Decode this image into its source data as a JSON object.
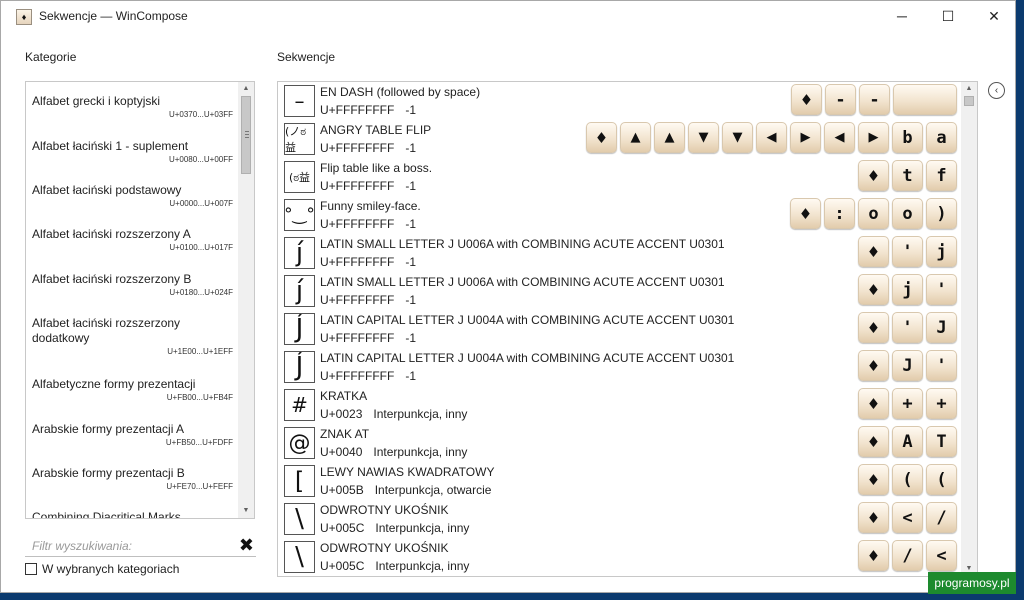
{
  "window": {
    "title": "Sekwencje — WinCompose",
    "icon": "compose-diamond-icon",
    "controls": {
      "minimize": "─",
      "maximize": "☐",
      "close": "✕"
    }
  },
  "categories": {
    "label": "Kategorie",
    "items": [
      {
        "name": "Alfabet grecki i koptyjski",
        "range": "U+0370...U+03FF"
      },
      {
        "name": "Alfabet łaciński 1 - suplement",
        "range": "U+0080...U+00FF"
      },
      {
        "name": "Alfabet łaciński podstawowy",
        "range": "U+0000...U+007F"
      },
      {
        "name": "Alfabet łaciński rozszerzony A",
        "range": "U+0100...U+017F"
      },
      {
        "name": "Alfabet łaciński rozszerzony B",
        "range": "U+0180...U+024F"
      },
      {
        "name": "Alfabet łaciński rozszerzony dodatkowy",
        "range": "U+1E00...U+1EFF"
      },
      {
        "name": "Alfabetyczne formy prezentacji",
        "range": "U+FB00...U+FB4F"
      },
      {
        "name": "Arabskie formy prezentacji A",
        "range": "U+FB50...U+FDFF"
      },
      {
        "name": "Arabskie formy prezentacji B",
        "range": "U+FE70...U+FEFF"
      },
      {
        "name": "Combining Diacritical Marks",
        "range": ""
      }
    ],
    "filter_placeholder": "Filtr wyszukiwania:",
    "clear_icon": "✖",
    "checkbox_label": "W wybranych kategoriach",
    "checkbox_checked": false
  },
  "sequences": {
    "label": "Sekwencje",
    "rows": [
      {
        "glyph": "–",
        "desc": "EN DASH (followed by space)",
        "code": "U+FFFFFFFF",
        "info": "-1",
        "keys": [
          "♦",
          "-",
          "-",
          " "
        ]
      },
      {
        "glyph": "(ノಠ益",
        "desc": "ANGRY TABLE FLIP",
        "code": "U+FFFFFFFF",
        "info": "-1",
        "keys": [
          "♦",
          "▲",
          "▲",
          "▼",
          "▼",
          "◀",
          "▶",
          "◀",
          "▶",
          "b",
          "a"
        ]
      },
      {
        "glyph": "(ಠ益",
        "desc": "Flip table like a boss.",
        "code": "U+FFFFFFFF",
        "info": "-1",
        "keys": [
          "♦",
          "t",
          "f"
        ]
      },
      {
        "glyph": "°‿°",
        "desc": "Funny smiley-face.",
        "code": "U+FFFFFFFF",
        "info": "-1",
        "keys": [
          "♦",
          ":",
          "o",
          "o",
          ")"
        ]
      },
      {
        "glyph": "j́",
        "desc": "LATIN SMALL LETTER J U006A with COMBINING ACUTE ACCENT U0301",
        "code": "U+FFFFFFFF",
        "info": "-1",
        "keys": [
          "♦",
          "'",
          "j"
        ]
      },
      {
        "glyph": "j́",
        "desc": "LATIN SMALL LETTER J U006A with COMBINING ACUTE ACCENT U0301",
        "code": "U+FFFFFFFF",
        "info": "-1",
        "keys": [
          "♦",
          "j",
          "'"
        ]
      },
      {
        "glyph": "J́",
        "desc": "LATIN CAPITAL LETTER J U004A with COMBINING ACUTE ACCENT U0301",
        "code": "U+FFFFFFFF",
        "info": "-1",
        "keys": [
          "♦",
          "'",
          "J"
        ]
      },
      {
        "glyph": "J́",
        "desc": "LATIN CAPITAL LETTER J U004A with COMBINING ACUTE ACCENT U0301",
        "code": "U+FFFFFFFF",
        "info": "-1",
        "keys": [
          "♦",
          "J",
          "'"
        ]
      },
      {
        "glyph": "#",
        "desc": "KRATKA",
        "code": "U+0023",
        "info": "Interpunkcja, inny",
        "keys": [
          "♦",
          "+",
          "+"
        ]
      },
      {
        "glyph": "@",
        "desc": "ZNAK AT",
        "code": "U+0040",
        "info": "Interpunkcja, inny",
        "keys": [
          "♦",
          "A",
          "T"
        ]
      },
      {
        "glyph": "[",
        "desc": "LEWY NAWIAS KWADRATOWY",
        "code": "U+005B",
        "info": "Interpunkcja, otwarcie",
        "keys": [
          "♦",
          "(",
          "("
        ]
      },
      {
        "glyph": "\\",
        "desc": "ODWROTNY UKOŚNIK",
        "code": "U+005C",
        "info": "Interpunkcja, inny",
        "keys": [
          "♦",
          "<",
          "/"
        ]
      },
      {
        "glyph": "\\",
        "desc": "ODWROTNY UKOŚNIK",
        "code": "U+005C",
        "info": "Interpunkcja, inny",
        "keys": [
          "♦",
          "/",
          "<"
        ]
      }
    ]
  },
  "side_button_icon": "chevron-left-circle-icon",
  "side_button_glyph": "‹",
  "watermark": "programosy.pl"
}
